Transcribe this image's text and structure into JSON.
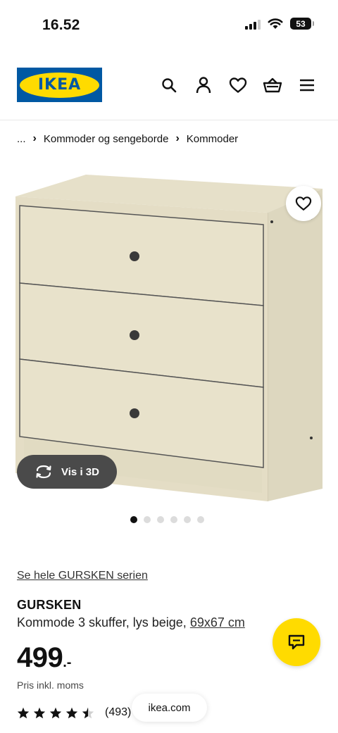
{
  "status_bar": {
    "time": "16.52",
    "battery": "53"
  },
  "header": {
    "logo_text": "IKEA",
    "brand_color": "#0058a3",
    "accent_color": "#ffdb00",
    "icons": [
      "search-icon",
      "user-icon",
      "heart-icon",
      "basket-icon",
      "menu-icon"
    ]
  },
  "breadcrumb": {
    "items": [
      "...",
      "Kommoder og sengeborde",
      "Kommoder"
    ]
  },
  "gallery": {
    "vis3d_label": "Vis i 3D",
    "dot_count": 6,
    "active_dot": 0
  },
  "product": {
    "series_link": "Se hele GURSKEN serien",
    "name": "GURSKEN",
    "description": "Kommode 3 skuffer, lys beige,",
    "size": "69x67 cm",
    "price_int": "499",
    "price_dec": ".-",
    "price_note": "Pris inkl. moms",
    "rating_value": 4.5,
    "rating_count": "(493)"
  },
  "browser": {
    "url": "ikea.com"
  }
}
